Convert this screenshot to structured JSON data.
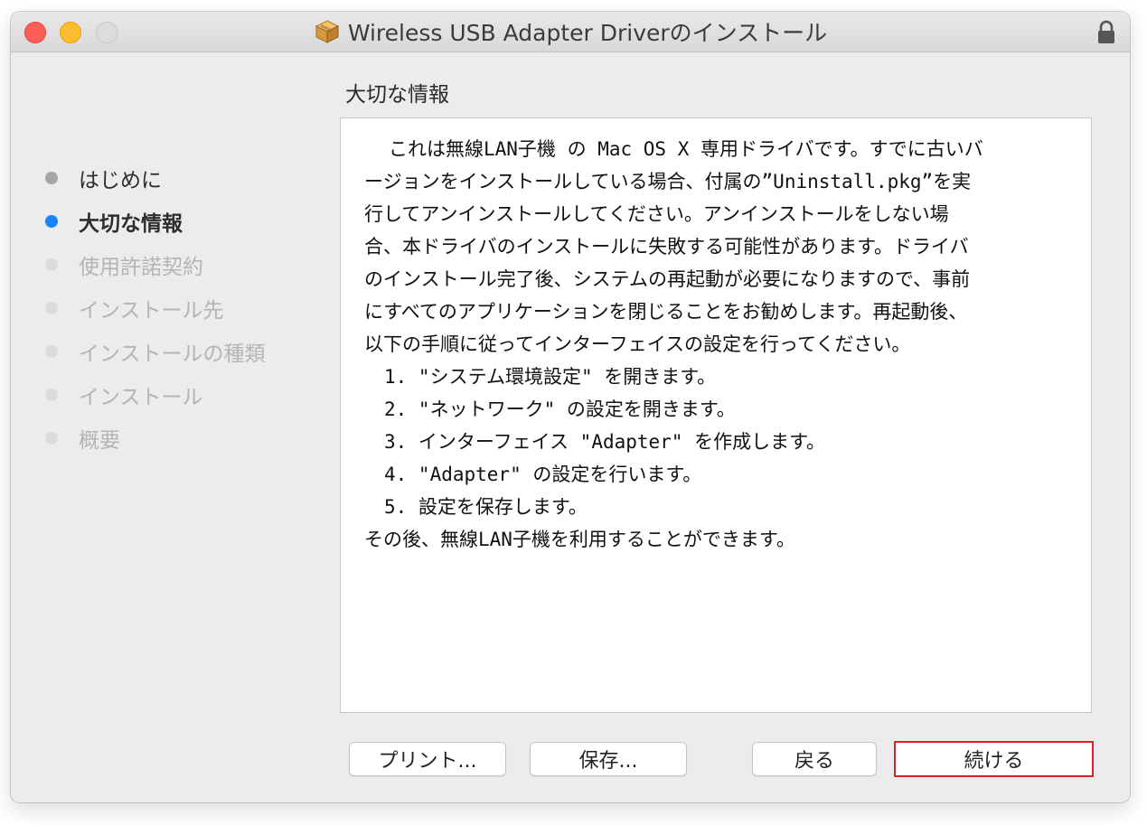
{
  "window": {
    "title": "Wireless USB Adapter Driverのインストール"
  },
  "colors": {
    "close": "#fd5f57",
    "minimize": "#fdbc2e",
    "zoom": "#dcdcdc",
    "current_step": "#1a82fb",
    "highlight": "#e0202a"
  },
  "icons": {
    "title": "package-icon",
    "titlebar_right": "lock-icon"
  },
  "sidebar": {
    "steps": [
      {
        "label": "はじめに",
        "state": "done"
      },
      {
        "label": "大切な情報",
        "state": "current"
      },
      {
        "label": "使用許諾契約",
        "state": "pending"
      },
      {
        "label": "インストール先",
        "state": "pending"
      },
      {
        "label": "インストールの種類",
        "state": "pending"
      },
      {
        "label": "インストール",
        "state": "pending"
      },
      {
        "label": "概要",
        "state": "pending"
      }
    ]
  },
  "main": {
    "section_title": "大切な情報",
    "lines": [
      "これは無線LAN子機 の Mac OS X 専用ドライバです。すでに古いバ",
      "ージョンをインストールしている場合、付属の”Uninstall.pkg”を実",
      "行してアンインストールしてください。アンインストールをしない場",
      "合、本ドライバのインストールに失敗する可能性があります。ドライバ",
      "のインストール完了後、システムの再起動が必要になりますので、事前",
      "にすべてのアプリケーションを閉じることをお勧めします。再起動後、",
      "以下の手順に従ってインターフェイスの設定を行ってください。",
      "1. \"システム環境設定\" を開きます。",
      "2. \"ネットワーク\" の設定を開きます。",
      "3. インターフェイス \"Adapter\" を作成します。",
      "4. \"Adapter\" の設定を行います。",
      "5. 設定を保存します。",
      "その後、無線LAN子機を利用することができます。"
    ]
  },
  "buttons": {
    "print": "プリント...",
    "save": "保存...",
    "back": "戻る",
    "continue": "続ける"
  }
}
